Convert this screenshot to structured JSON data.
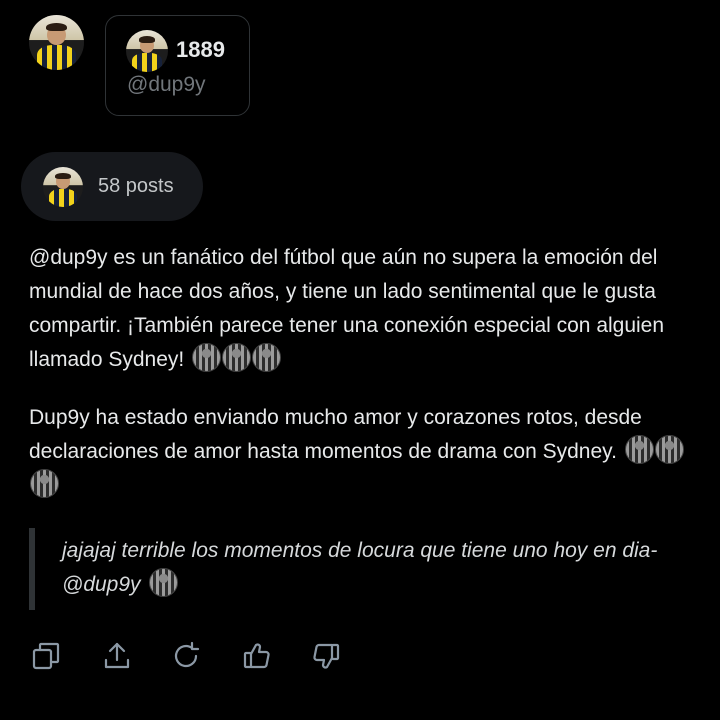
{
  "profile": {
    "name": "1889",
    "handle": "@dup9y"
  },
  "posts_pill": {
    "label": "58 posts"
  },
  "summary": {
    "paragraph1": "@dup9y es un fanático del fútbol que aún no supera la emoción del mundial de hace dos años, y tiene un lado sentimental que le gusta compartir. ¡También parece tener una conexión especial con alguien llamado Sydney!",
    "paragraph2": "Dup9y ha estado enviando mucho amor y corazones rotos, desde declaraciones de amor hasta momentos de drama con Sydney.",
    "quote": "jajajaj terrible los momentos de locura que tiene uno hoy en dia-@dup9y"
  },
  "actions": [
    {
      "name": "copy-icon"
    },
    {
      "name": "share-icon"
    },
    {
      "name": "regenerate-icon"
    },
    {
      "name": "thumbs-up-icon"
    },
    {
      "name": "thumbs-down-icon"
    }
  ],
  "colors": {
    "background": "#000000",
    "text": "#e7e9ea",
    "muted": "#71767b",
    "pill_bg": "#16181c",
    "icon": "#8b98a5"
  }
}
